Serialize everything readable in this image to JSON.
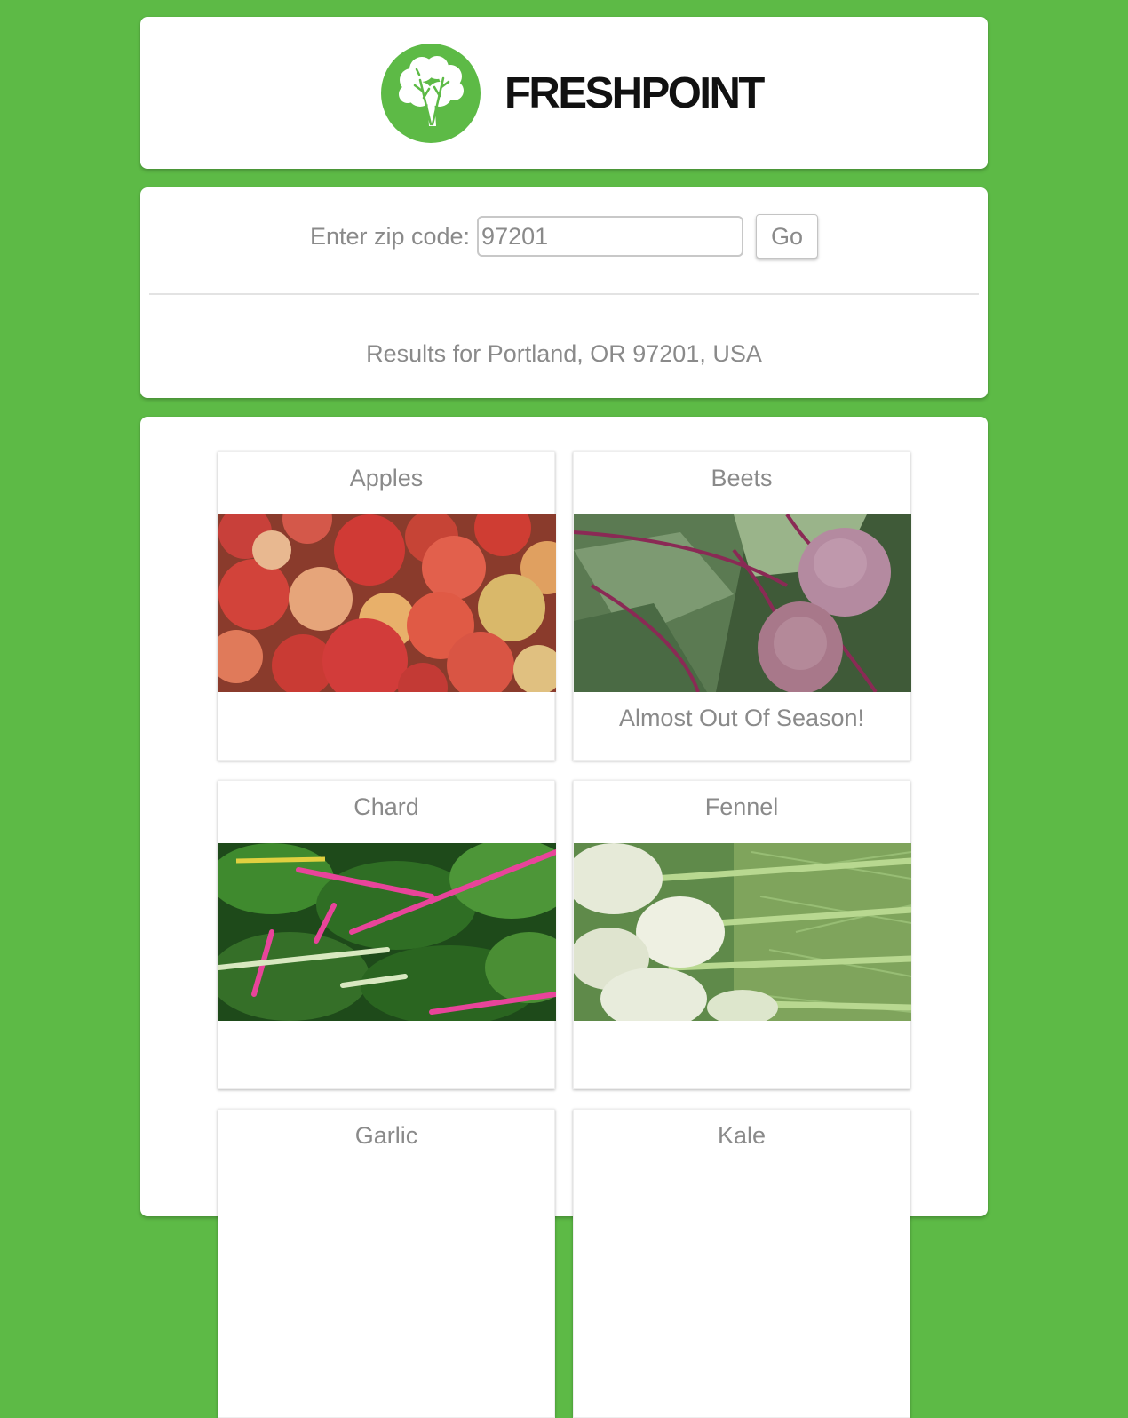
{
  "header": {
    "brand": "FRESHPOINT",
    "logo_icon": "leafy-greens-icon"
  },
  "search": {
    "label": "Enter zip code:",
    "zip_value": "97201",
    "go_label": "Go",
    "results_text": "Results for Portland, OR 97201, USA"
  },
  "produce": [
    {
      "name": "Apples",
      "note": "",
      "image": "apples-photo"
    },
    {
      "name": "Beets",
      "note": "Almost Out Of Season!",
      "image": "beets-photo"
    },
    {
      "name": "Chard",
      "note": "",
      "image": "chard-photo"
    },
    {
      "name": "Fennel",
      "note": "",
      "image": "fennel-photo"
    },
    {
      "name": "Garlic",
      "note": "",
      "image": "garlic-photo"
    },
    {
      "name": "Kale",
      "note": "",
      "image": "kale-photo"
    }
  ],
  "colors": {
    "background": "#5dba46",
    "text_muted": "#8a8a8a",
    "brand_text": "#111111"
  }
}
